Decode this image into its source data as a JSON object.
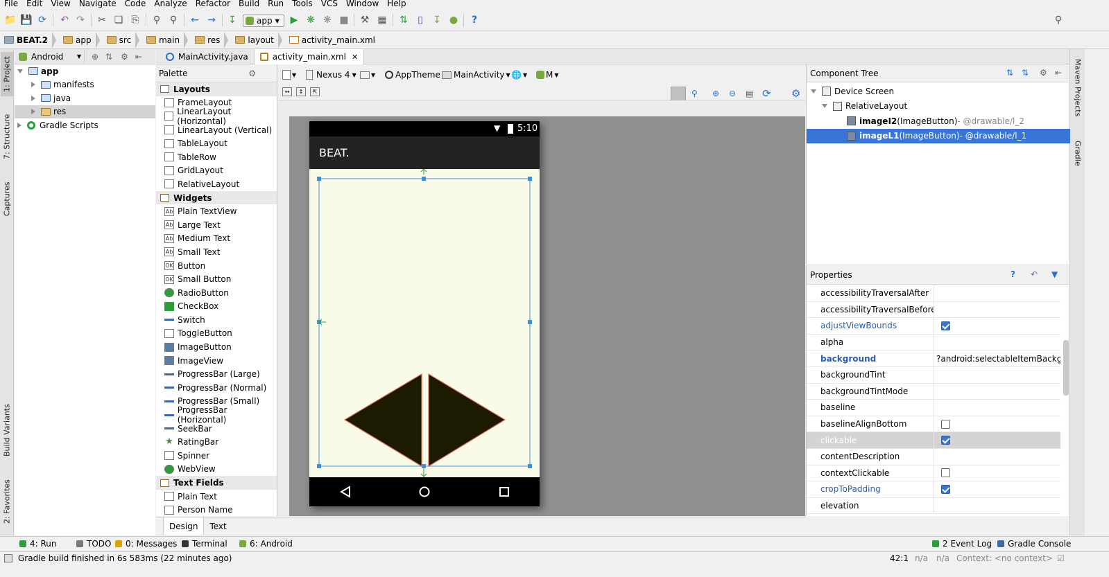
{
  "menu": [
    "File",
    "Edit",
    "View",
    "Navigate",
    "Code",
    "Analyze",
    "Refactor",
    "Build",
    "Run",
    "Tools",
    "VCS",
    "Window",
    "Help"
  ],
  "toolbar": {
    "run_config": "app"
  },
  "breadcrumb": [
    "BEAT.2",
    "app",
    "src",
    "main",
    "res",
    "layout",
    "activity_main.xml"
  ],
  "project_panel": {
    "view_selector": "Android",
    "tree": [
      {
        "label": "app",
        "level": 0,
        "expanded": true
      },
      {
        "label": "manifests",
        "level": 1,
        "expanded": false
      },
      {
        "label": "java",
        "level": 1,
        "expanded": false
      },
      {
        "label": "res",
        "level": 1,
        "expanded": false,
        "selected": true
      },
      {
        "label": "Gradle Scripts",
        "level": 0,
        "expanded": false
      }
    ]
  },
  "left_tool_tabs": [
    "1: Project",
    "7: Structure",
    "Captures",
    "Build Variants",
    "2: Favorites"
  ],
  "right_tool_tabs": [
    "Maven Projects",
    "Gradle"
  ],
  "editor_tabs": [
    {
      "label": "MainActivity.java",
      "active": false
    },
    {
      "label": "activity_main.xml",
      "active": true
    }
  ],
  "palette": {
    "title": "Palette",
    "groups": [
      {
        "name": "Layouts",
        "items": [
          "FrameLayout",
          "LinearLayout (Horizontal)",
          "LinearLayout (Vertical)",
          "TableLayout",
          "TableRow",
          "GridLayout",
          "RelativeLayout"
        ]
      },
      {
        "name": "Widgets",
        "items": [
          "Plain TextView",
          "Large Text",
          "Medium Text",
          "Small Text",
          "Button",
          "Small Button",
          "RadioButton",
          "CheckBox",
          "Switch",
          "ToggleButton",
          "ImageButton",
          "ImageView",
          "ProgressBar (Large)",
          "ProgressBar (Normal)",
          "ProgressBar (Small)",
          "ProgressBar (Horizontal)",
          "SeekBar",
          "RatingBar",
          "Spinner",
          "WebView"
        ]
      },
      {
        "name": "Text Fields",
        "items": [
          "Plain Text",
          "Person Name"
        ]
      }
    ]
  },
  "design_toolbar": {
    "device": "Nexus 4",
    "theme": "AppTheme",
    "activity": "MainActivity",
    "api": "M"
  },
  "phone": {
    "time": "5:10",
    "app_title": "BEAT."
  },
  "design_tabs": [
    {
      "label": "Design",
      "active": true
    },
    {
      "label": "Text",
      "active": false
    }
  ],
  "component_tree": {
    "title": "Component Tree",
    "nodes": [
      {
        "label": "Device Screen",
        "detail": ""
      },
      {
        "label": "RelativeLayout",
        "detail": ""
      },
      {
        "label": "imageI2",
        "detail": " (ImageButton)",
        "ref": " - @drawable/l_2",
        "selected": false
      },
      {
        "label": "imageL1",
        "detail": " (ImageButton)",
        "ref": " - @drawable/l_1",
        "selected": true
      }
    ]
  },
  "properties": {
    "title": "Properties",
    "rows": [
      {
        "name": "accessibilityTraversalAfter",
        "value": "",
        "checkbox": null,
        "style": "normal"
      },
      {
        "name": "accessibilityTraversalBefore",
        "value": "",
        "checkbox": null,
        "style": "normal"
      },
      {
        "name": "adjustViewBounds",
        "value": "",
        "checkbox": true,
        "style": "modified"
      },
      {
        "name": "alpha",
        "value": "",
        "checkbox": null,
        "style": "normal"
      },
      {
        "name": "background",
        "value": "?android:selectableItemBackgroun",
        "checkbox": null,
        "style": "bold"
      },
      {
        "name": "backgroundTint",
        "value": "",
        "checkbox": null,
        "style": "normal"
      },
      {
        "name": "backgroundTintMode",
        "value": "",
        "checkbox": null,
        "style": "normal"
      },
      {
        "name": "baseline",
        "value": "",
        "checkbox": null,
        "style": "normal"
      },
      {
        "name": "baselineAlignBottom",
        "value": "",
        "checkbox": false,
        "style": "normal"
      },
      {
        "name": "clickable",
        "value": "",
        "checkbox": true,
        "style": "highlight"
      },
      {
        "name": "contentDescription",
        "value": "",
        "checkbox": null,
        "style": "normal"
      },
      {
        "name": "contextClickable",
        "value": "",
        "checkbox": false,
        "style": "normal"
      },
      {
        "name": "cropToPadding",
        "value": "",
        "checkbox": true,
        "style": "modified"
      },
      {
        "name": "elevation",
        "value": "",
        "checkbox": null,
        "style": "normal"
      }
    ]
  },
  "tool_windows": [
    {
      "label": "4: Run",
      "color": "#2e9e3a"
    },
    {
      "label": "TODO",
      "color": "#777777"
    },
    {
      "label": "0: Messages",
      "color": "#d8a200"
    },
    {
      "label": "Terminal",
      "color": "#333333"
    },
    {
      "label": "6: Android",
      "color": "#78a93c"
    }
  ],
  "tool_windows_right": [
    {
      "label": "2  Event Log",
      "color": "#2e9e3a"
    },
    {
      "label": "Gradle Console",
      "color": "#3b6aa8"
    }
  ],
  "status": {
    "message": "Gradle build finished in 6s 583ms (22 minutes ago)",
    "position": "42:1",
    "na1": "n/a",
    "na2": "n/a",
    "context": "Context: <no context>"
  },
  "colors": {
    "selection": "#3875d7",
    "modified": "#2a5db0",
    "canvas": "#8f8f8f",
    "screen": "#fafae8"
  }
}
